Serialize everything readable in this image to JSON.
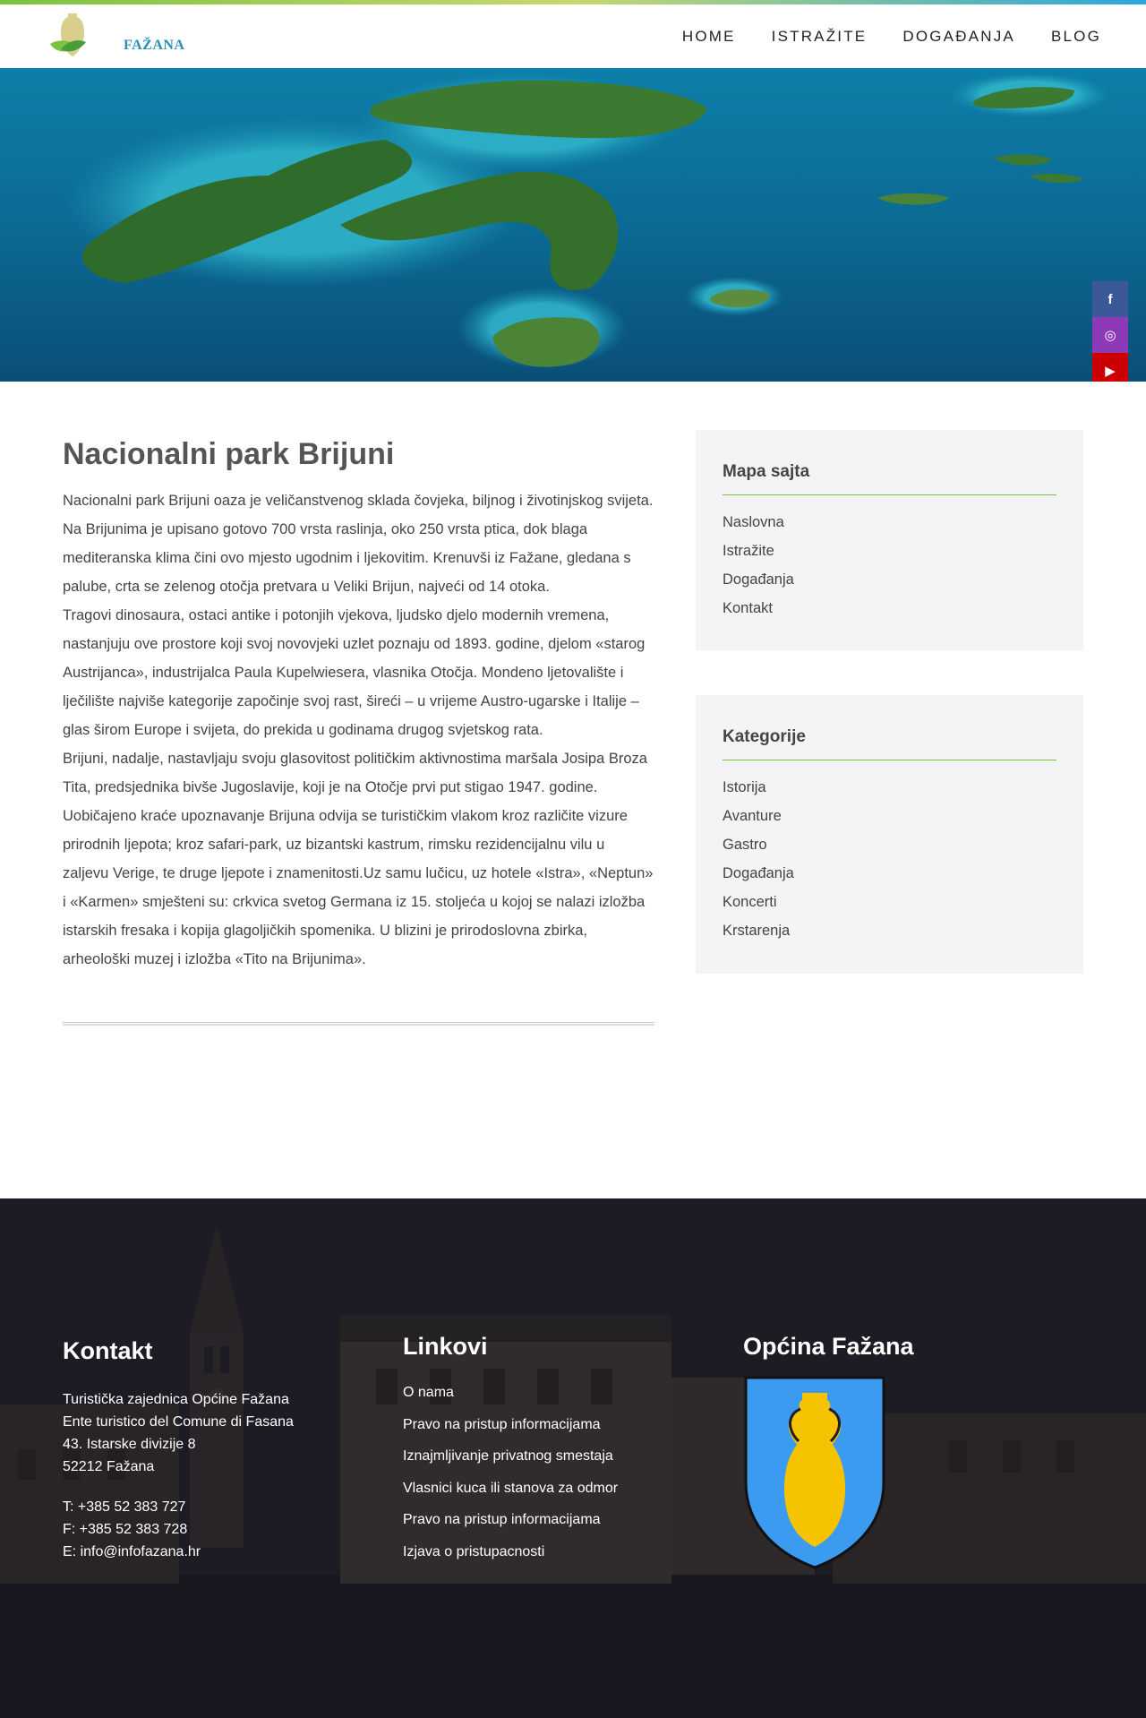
{
  "nav": {
    "home": "HOME",
    "explore": "ISTRAŽITE",
    "events": "DOGAĐANJA",
    "blog": "BLOG"
  },
  "logo": {
    "text": "FAŽANA"
  },
  "social": {
    "facebook": "f",
    "instagram": "◎",
    "youtube": "▶"
  },
  "article": {
    "title": "Nacionalni park Brijuni",
    "paragraphs": [
      "Nacionalni park Brijuni oaza je veličanstvenog sklada čovjeka, biljnog i životinjskog svijeta. Na Brijunima je upisano gotovo 700 vrsta raslinja, oko 250 vrsta ptica, dok blaga mediteranska klima čini ovo mjesto ugodnim i ljekovitim. Krenuvši iz Fažane, gledana s palube, crta se zelenog otočja pretvara u Veliki Brijun, najveći od 14 otoka.",
      "Tragovi dinosaura, ostaci antike i potonjih vjekova, ljudsko djelo modernih vremena, nastanjuju ove prostore koji svoj novovjeki uzlet poznaju od 1893. godine, djelom «starog Austrijanca», industrijalca Paula Kupelwiesera, vlasnika Otočja. Mondeno ljetovalište i lječilište najviše kategorije započinje svoj rast, šireći – u vrijeme Austro-ugarske i Italije – glas širom Europe i svijeta, do prekida u godinama drugog svjetskog rata.",
      "Brijuni, nadalje, nastavljaju svoju glasovitost političkim aktivnostima maršala Josipa Broza Tita, predsjednika bivše Jugoslavije, koji je na Otočje prvi put stigao 1947. godine.",
      "Uobičajeno kraće upoznavanje Brijuna odvija se turističkim vlakom kroz različite vizure prirodnih ljepota; kroz safari-park, uz bizantski kastrum, rimsku rezidencijalnu vilu u zaljevu Verige, te druge ljepote i znamenitosti.Uz samu lučicu, uz hotele «Istra», «Neptun» i «Karmen» smješteni su: crkvica svetog Germana iz 15. stoljeća u kojoj se nalazi izložba istarskih fresaka i kopija glagoljičkih spomenika. U blizini je prirodoslovna zbirka, arheološki muzej i izložba «Tito na Brijunima»."
    ]
  },
  "sitemap": {
    "title": "Mapa sajta",
    "items": [
      "Naslovna",
      "Istražite",
      "Događanja",
      "Kontakt"
    ]
  },
  "categories": {
    "title": "Kategorije",
    "items": [
      "Istorija",
      "Avanture",
      "Gastro",
      "Događanja",
      "Koncerti",
      "Krstarenja"
    ]
  },
  "footer": {
    "contact": {
      "title": "Kontakt",
      "lines": [
        "Turistička zajednica Općine Fažana",
        "Ente turistico del Comune di Fasana",
        "43. Istarske divizije 8",
        "52212 Fažana"
      ],
      "phone": "T: +385 52 383 727",
      "fax": "F: +385 52 383 728",
      "email": "E: info@infofazana.hr"
    },
    "links": {
      "title": "Linkovi",
      "items": [
        "O nama",
        "Pravo na pristup informacijama",
        "Iznajmljivanje privatnog smestaja",
        "Vlasnici kuca ili stanova za odmor",
        "Pravo na pristup informacijama",
        "Izjava o pristupacnosti"
      ]
    },
    "municipality": {
      "title": "Općina Fažana"
    }
  },
  "colors": {
    "accent_green": "#7cc242",
    "facebook": "#3b5998",
    "instagram": "#8e3ab8",
    "youtube": "#cc0000",
    "footer_bg": "#1e1c25",
    "shield_blue": "#3a9bf0",
    "amphora_yellow": "#f6c300"
  }
}
